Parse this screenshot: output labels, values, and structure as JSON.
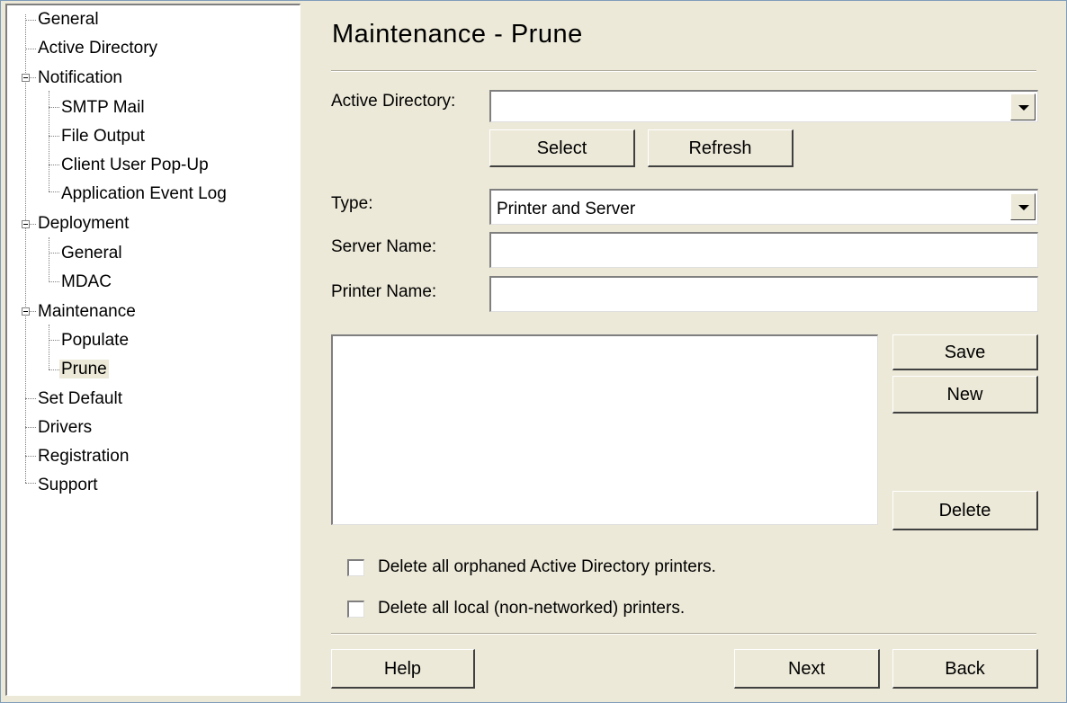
{
  "tree": {
    "items": [
      {
        "label": "General"
      },
      {
        "label": "Active Directory"
      },
      {
        "label": "Notification"
      },
      {
        "label": "SMTP Mail"
      },
      {
        "label": "File Output"
      },
      {
        "label": "Client User Pop-Up"
      },
      {
        "label": "Application Event Log"
      },
      {
        "label": "Deployment"
      },
      {
        "label": "General"
      },
      {
        "label": "MDAC"
      },
      {
        "label": "Maintenance"
      },
      {
        "label": "Populate"
      },
      {
        "label": "Prune"
      },
      {
        "label": "Set Default"
      },
      {
        "label": "Drivers"
      },
      {
        "label": "Registration"
      },
      {
        "label": "Support"
      }
    ],
    "selected": "Prune"
  },
  "page": {
    "title": "Maintenance - Prune"
  },
  "form": {
    "active_directory_label": "Active Directory:",
    "active_directory_value": "",
    "select_button": "Select",
    "refresh_button": "Refresh",
    "type_label": "Type:",
    "type_value": "Printer and Server",
    "server_name_label": "Server Name:",
    "server_name_value": "",
    "printer_name_label": "Printer Name:",
    "printer_name_value": ""
  },
  "list_buttons": {
    "save": "Save",
    "new": "New",
    "delete": "Delete"
  },
  "options": {
    "delete_orphaned": {
      "label": "Delete all orphaned Active Directory printers.",
      "checked": false
    },
    "delete_local": {
      "label": "Delete all local (non-networked) printers.",
      "checked": false
    }
  },
  "footer": {
    "help": "Help",
    "next": "Next",
    "back": "Back"
  }
}
